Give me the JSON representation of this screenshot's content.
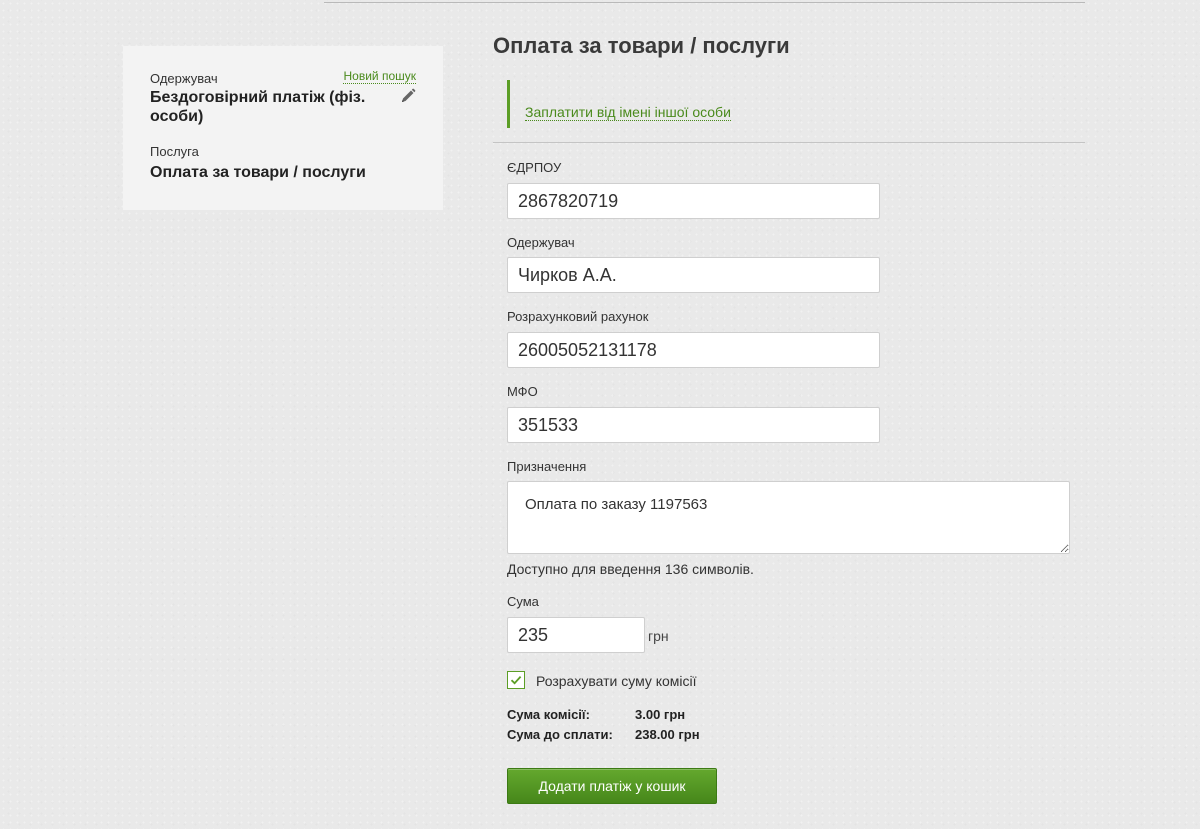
{
  "summary": {
    "recipient_label": "Одержувач",
    "new_search_link": "Новий пошук",
    "recipient_value": "Бездоговірний платіж (фіз. особи)",
    "edit_icon": "pencil-icon",
    "service_label": "Послуга",
    "service_value": "Оплата за товари / послуги"
  },
  "main": {
    "title": "Оплата за товари / послуги",
    "pay_other_link": "Заплатити від імені іншої особи"
  },
  "form": {
    "edrpou": {
      "label": "ЄДРПОУ",
      "value": "2867820719"
    },
    "recipient": {
      "label": "Одержувач",
      "value": "Чирков А.А."
    },
    "account": {
      "label": "Розрахунковий рахунок",
      "value": "26005052131178"
    },
    "mfo": {
      "label": "МФО",
      "value": "351533"
    },
    "purpose": {
      "label": "Призначення",
      "value": "Оплата по заказу 1197563",
      "chars_left": "Доступно для введення 136 символів."
    },
    "amount": {
      "label": "Сума",
      "value": "235",
      "currency": "грн"
    },
    "commission_checkbox": {
      "label": "Розрахувати суму комісії",
      "checked": true
    },
    "commission_summary": {
      "commission_label": "Сума комісії:",
      "commission_value": "3.00 грн",
      "total_label": "Сума до сплати:",
      "total_value": "238.00 грн"
    },
    "submit_label": "Додати платіж у кошик"
  },
  "colors": {
    "accent": "#5c9e26",
    "link": "#4a8a1c",
    "button_top": "#64a82e",
    "button_bottom": "#46871a",
    "background": "#e9e9e9",
    "card": "#f3f3f3"
  }
}
